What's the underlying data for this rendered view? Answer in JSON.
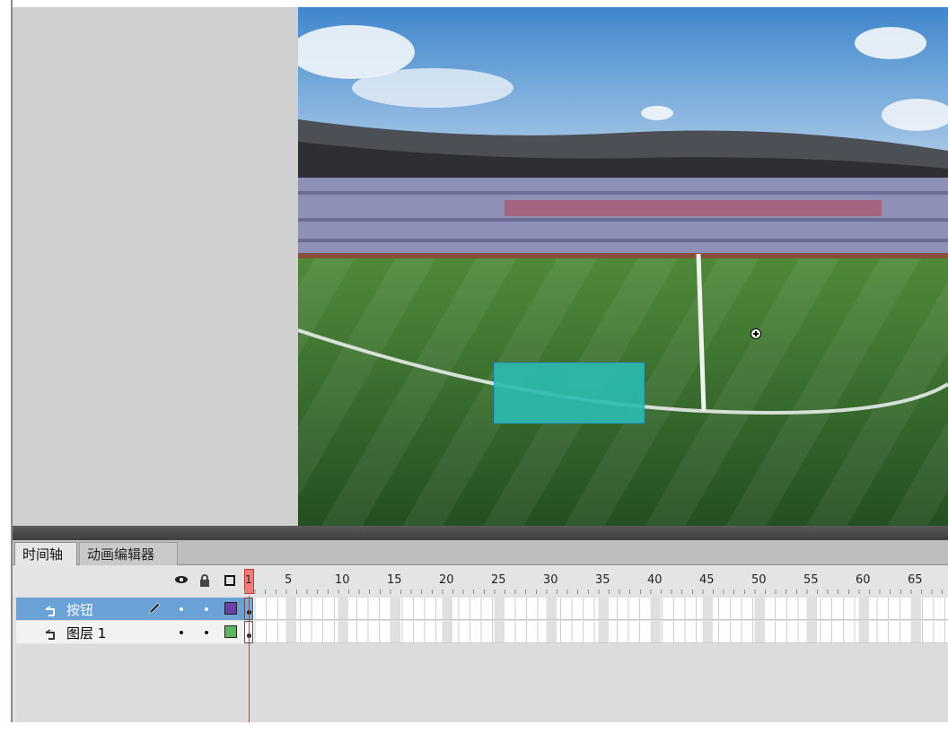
{
  "timeline_panel": {
    "tabs": [
      {
        "label": "时间轴",
        "active": true
      },
      {
        "label": "动画编辑器",
        "active": false
      }
    ],
    "playhead_frame": "1",
    "ruler_numbers": [
      "5",
      "10",
      "15",
      "20",
      "25",
      "30",
      "35",
      "40",
      "45",
      "50",
      "55",
      "60",
      "65"
    ],
    "header_icons": [
      "eye-icon",
      "lock-icon",
      "outline-icon"
    ],
    "layers": [
      {
        "name": "按钮",
        "selected": true,
        "color": "#6b3fa8",
        "editing": true
      },
      {
        "name": "图层 1",
        "selected": false,
        "color": "#5cb85c",
        "editing": false
      }
    ]
  },
  "stage": {
    "object": "button-shape",
    "object_color": "#2bbbaf",
    "scene": "stadium-photo"
  },
  "colors": {
    "selection": "#6aa2d8",
    "playhead": "#e03030",
    "pasteboard": "#cfcfcf"
  }
}
